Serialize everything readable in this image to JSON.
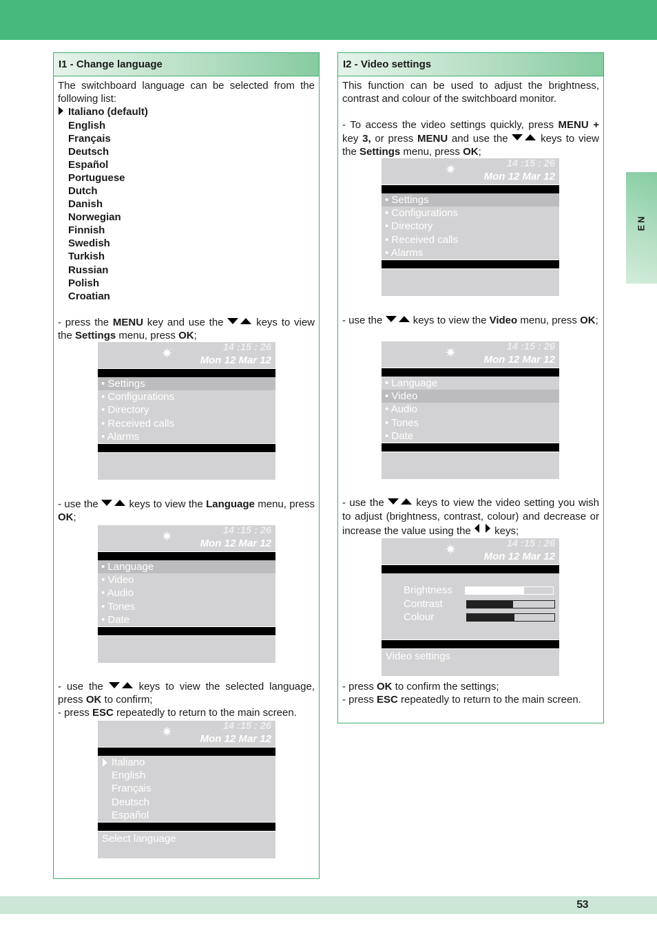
{
  "page": {
    "number": "53",
    "language_tab": "EN",
    "accent_color": "#47b97d"
  },
  "screen_common": {
    "sun_icon": "✷",
    "time": "14 :15 : 26",
    "date": "Mon 12 Mar 12"
  },
  "section1": {
    "title": "I1 - Change language",
    "intro": "The switchboard language can be selected from the following list:",
    "languages": [
      {
        "label": "Italiano (default)",
        "marker": true
      },
      {
        "label": "English"
      },
      {
        "label": "Français"
      },
      {
        "label": "Deutsch"
      },
      {
        "label": "Español"
      },
      {
        "label": "Portuguese"
      },
      {
        "label": "Dutch"
      },
      {
        "label": "Danish"
      },
      {
        "label": "Norwegian"
      },
      {
        "label": "Finnish"
      },
      {
        "label": "Swedish"
      },
      {
        "label": "Turkish"
      },
      {
        "label": "Russian"
      },
      {
        "label": "Polish"
      },
      {
        "label": "Croatian"
      }
    ],
    "step1": {
      "t1": "- press the ",
      "b1": "MENU",
      "t2": " key and use the ",
      "t3": " keys to view the ",
      "b2": "Settings",
      "t4": " menu, press ",
      "b3": "OK",
      "t5": ";"
    },
    "screen1": {
      "items": [
        "• Settings",
        "• Configurations",
        "• Directory",
        "• Received calls",
        "• Alarms"
      ],
      "selected_index": 0,
      "footer": ""
    },
    "step2": {
      "t1": "- use the ",
      "t2": " keys to view the ",
      "b1": "Language",
      "t3": " menu, press ",
      "b2": "OK",
      "t4": ";"
    },
    "screen2": {
      "items": [
        "• Language",
        "• Video",
        "• Audio",
        "• Tones",
        "• Date"
      ],
      "selected_index": 0,
      "footer": ""
    },
    "step3": {
      "t1": "- use the ",
      "t2": " keys to view the selected language, press ",
      "b1": "OK",
      "t3": " to confirm;"
    },
    "step4": {
      "t1": "- press ",
      "b1": "ESC",
      "t2": " repeatedly to return to the main screen."
    },
    "screen3": {
      "items": [
        "Italiano",
        "English",
        "Français",
        "Deutsch",
        "Español"
      ],
      "selected_index": 0,
      "footer": "Select language"
    }
  },
  "section2": {
    "title": "I2 - Video settings",
    "intro": "This function can be used to adjust the brightness, contrast and colour of the switchboard monitor.",
    "step1": {
      "t1": "- To access the video settings quickly, press ",
      "b1": "MENU",
      "b2": "+",
      "t2": " key ",
      "b3": "3,",
      "t3": " or press ",
      "b4": "MENU",
      "t4": " and use the ",
      "t5": " keys to view the ",
      "b5": "Settings",
      "t6": " menu, press ",
      "b6": "OK",
      "t7": ";"
    },
    "screen1": {
      "items": [
        "• Settings",
        "• Configurations",
        "• Directory",
        "• Received calls",
        "• Alarms"
      ],
      "selected_index": 0,
      "footer": ""
    },
    "step2": {
      "t1": "- use the ",
      "t2": " keys to view the ",
      "b1": "Video",
      "t3": " menu, press ",
      "b2": "OK",
      "t4": ";"
    },
    "screen2": {
      "items": [
        "• Language",
        "• Video",
        "• Audio",
        "• Tones",
        "• Date"
      ],
      "selected_index": 1,
      "footer": ""
    },
    "step3": {
      "t1": "- use the ",
      "t2": " keys to view the video setting you wish to adjust (brightness, contrast, colour) and decrease or increase the value using the ",
      "t3": " keys;"
    },
    "screen3": {
      "settings": [
        {
          "label": "Brightness",
          "level": 0.67,
          "selected": true
        },
        {
          "label": "Contrast",
          "level": 0.53,
          "selected": false
        },
        {
          "label": "Colour",
          "level": 0.54,
          "selected": false
        }
      ],
      "footer": "Video settings"
    },
    "step4": {
      "t1": "- press ",
      "b1": "OK",
      "t2": " to confirm the settings;"
    },
    "step5": {
      "t1": "- press ",
      "b1": "ESC",
      "t2": " repeatedly to return to the main screen."
    }
  }
}
